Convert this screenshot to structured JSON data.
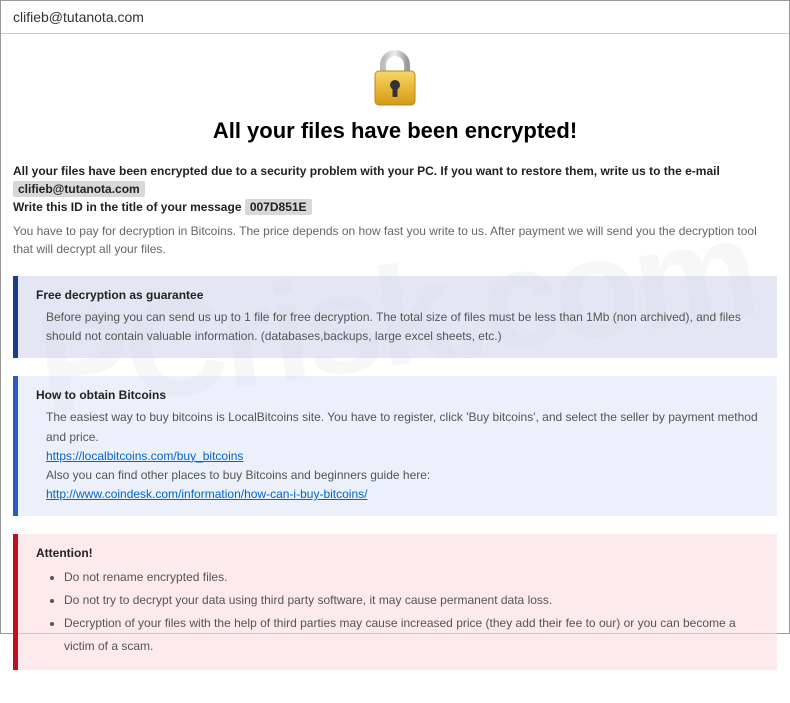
{
  "titlebar": {
    "title": "clifieb@tutanota.com"
  },
  "heading": "All your files have been encrypted!",
  "intro": {
    "line1_part1": "All your files have been encrypted due to a security problem with your PC. If you want to restore them, write us to the e-mail ",
    "email": "clifieb@tutanota.com",
    "line2_part1": "Write this ID in the title of your message ",
    "id": "007D851E"
  },
  "subintro": "You have to pay for decryption in Bitcoins. The price depends on how fast you write to us. After payment we will send you the decryption tool that will decrypt all your files.",
  "guarantee": {
    "title": "Free decryption as guarantee",
    "text": "Before paying you can send us up to 1 file for free decryption. The total size of files must be less than 1Mb (non archived), and files should not contain valuable information. (databases,backups, large excel sheets, etc.)"
  },
  "bitcoins": {
    "title": "How to obtain Bitcoins",
    "text1": "The easiest way to buy bitcoins is LocalBitcoins site. You have to register, click 'Buy bitcoins', and select the seller by payment method and price.",
    "link1": "https://localbitcoins.com/buy_bitcoins",
    "text2": "Also you can find other places to buy Bitcoins and beginners guide here:",
    "link2": "http://www.coindesk.com/information/how-can-i-buy-bitcoins/"
  },
  "attention": {
    "title": "Attention!",
    "items": [
      "Do not rename encrypted files.",
      "Do not try to decrypt your data using third party software, it may cause permanent data loss.",
      "Decryption of your files with the help of third parties may cause increased price (they add their fee to our) or you can become a victim of a scam."
    ]
  }
}
